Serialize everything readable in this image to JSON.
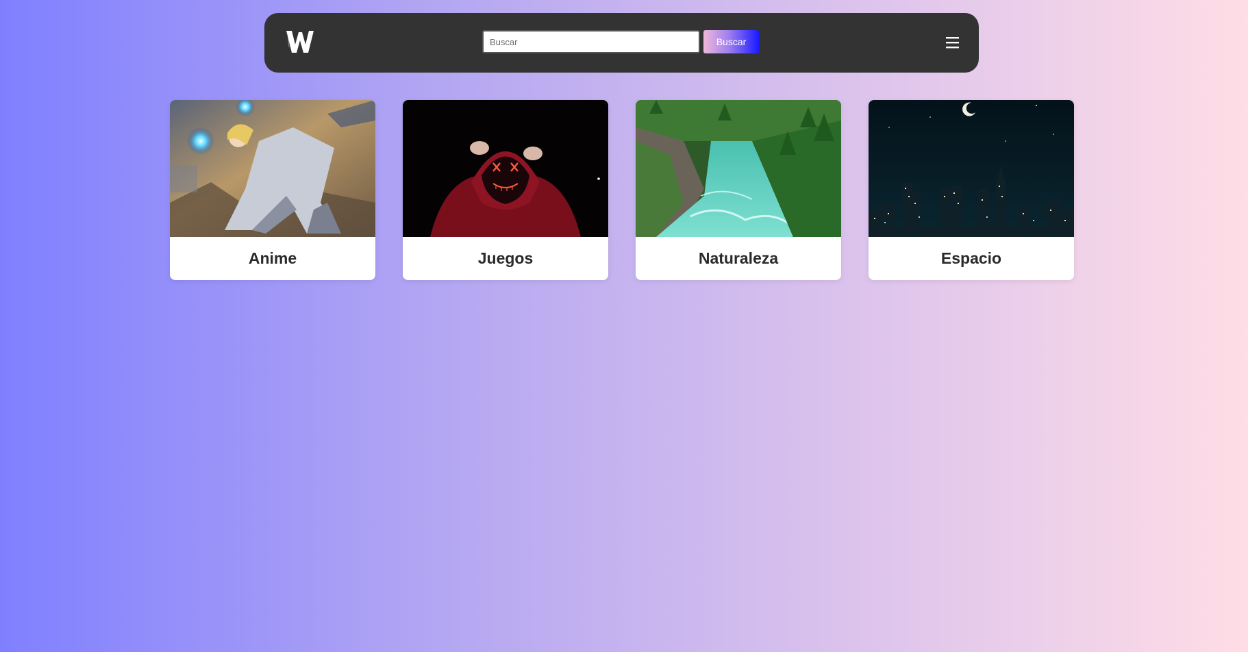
{
  "header": {
    "logo_icon": "w-logo-icon",
    "search": {
      "placeholder": "Buscar",
      "value": "",
      "button_label": "Buscar"
    },
    "menu_icon": "hamburger-menu-icon"
  },
  "categories": [
    {
      "title": "Anime",
      "image": "anime-warrior-image"
    },
    {
      "title": "Juegos",
      "image": "neon-mask-hoodie-image"
    },
    {
      "title": "Naturaleza",
      "image": "forest-river-image"
    },
    {
      "title": "Espacio",
      "image": "night-city-skyline-image"
    }
  ],
  "colors": {
    "header_bg": "#333333",
    "card_bg": "#ffffff",
    "bg_gradient_start": "#8080ff",
    "bg_gradient_end": "#ffdde6",
    "button_gradient_start": "#f0b8d8",
    "button_gradient_end": "#1a1aff"
  }
}
